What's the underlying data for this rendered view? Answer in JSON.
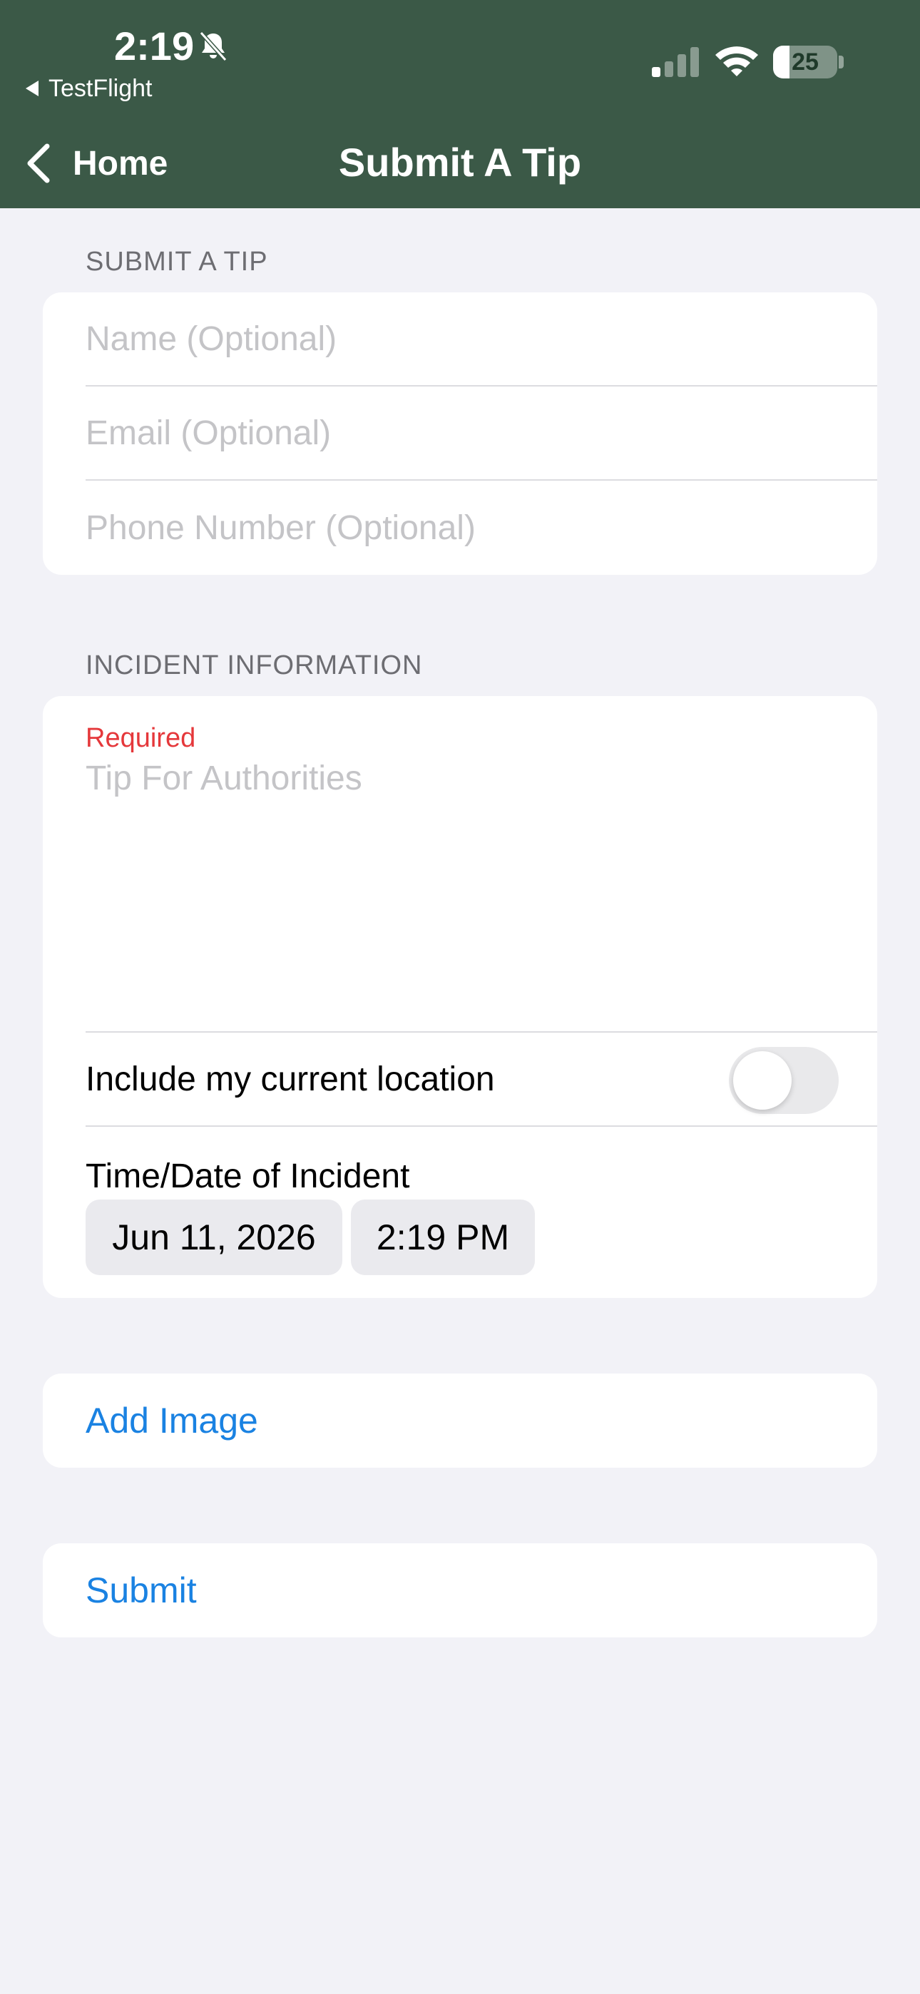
{
  "status_bar": {
    "time": "2:19",
    "back_app": "TestFlight",
    "battery_level": "25",
    "battery_fraction": 0.25,
    "icons": [
      "bell-slash-icon",
      "signal-icon",
      "wifi-icon",
      "battery-icon"
    ]
  },
  "nav": {
    "back_label": "Home",
    "title": "Submit A Tip"
  },
  "submit_section": {
    "header": "SUBMIT A TIP",
    "name_placeholder": "Name (Optional)",
    "email_placeholder": "Email (Optional)",
    "phone_placeholder": "Phone Number (Optional)"
  },
  "incident_section": {
    "header": "INCIDENT INFORMATION",
    "required_label": "Required",
    "tip_placeholder": "Tip For Authorities",
    "location_label": "Include my current location",
    "location_on": false,
    "datetime_label": "Time/Date of Incident",
    "date_value": "Jun 11, 2026",
    "time_value": "2:19 PM"
  },
  "actions": {
    "add_image": "Add Image",
    "submit": "Submit"
  },
  "colors": {
    "header_bg": "#3b5947",
    "page_bg": "#f2f2f7",
    "link_blue": "#1a82e2",
    "required_red": "#e5383b"
  }
}
